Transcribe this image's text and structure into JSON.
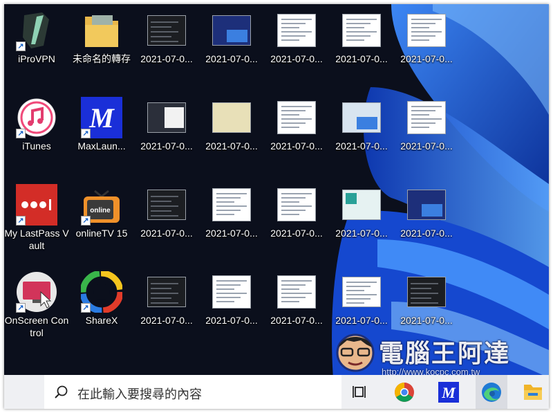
{
  "desktop": {
    "shortcuts": {
      "iprovpn": "iProVPN",
      "unnamed_folder": "未命名的轉存",
      "itunes": "iTunes",
      "maxlauncher": "MaxLaun...",
      "lastpass": "My LastPass Vault",
      "onlinetv": "onlineTV 15",
      "onscreen": "OnScreen Control",
      "sharex": "ShareX"
    },
    "file_label": "2021-07-0..."
  },
  "taskbar": {
    "search_placeholder": "在此輸入要搜尋的內容",
    "icons": [
      "task-view-icon",
      "chrome-icon",
      "maxlauncher-icon",
      "edge-icon",
      "file-explorer-icon"
    ]
  },
  "watermark": {
    "title": "電腦王阿達",
    "url": "http://www.kocpc.com.tw"
  },
  "colors": {
    "desktop_bg": "#0b0f1c",
    "wallpaper_blue": "#1e5bd8",
    "taskbar_bg": "#eff0f3",
    "lastpass_red": "#d32d27",
    "maxlauncher_blue": "#1a2fd8"
  }
}
